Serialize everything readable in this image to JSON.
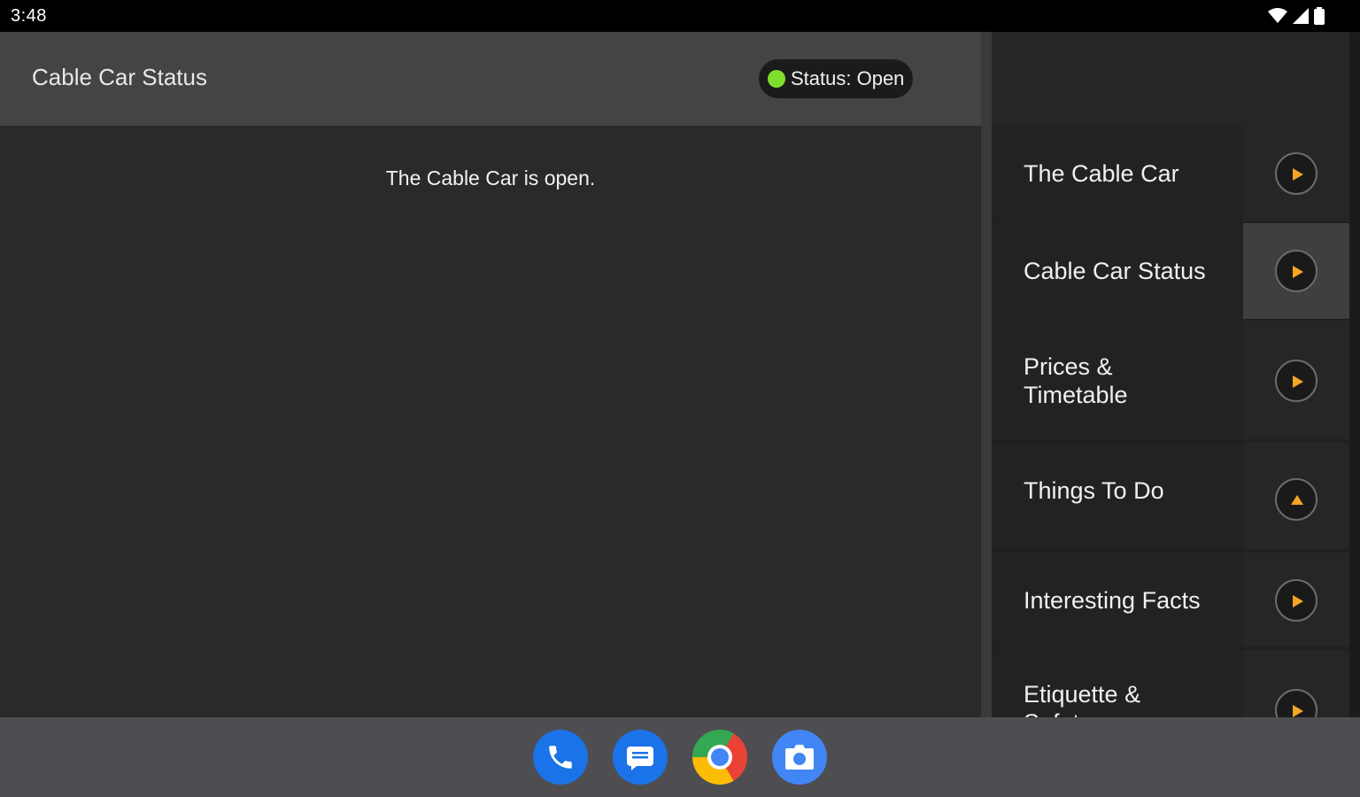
{
  "status_bar": {
    "time": "3:48",
    "icons": [
      "wifi-icon",
      "cell-signal-icon",
      "battery-icon"
    ]
  },
  "header": {
    "title": "Cable Car Status",
    "status_label": "Status: Open",
    "status_color": "#7ee02c"
  },
  "main": {
    "message": "The Cable Car is open."
  },
  "menu": {
    "items": [
      {
        "label": "The Cable Car",
        "icon": "play-icon"
      },
      {
        "label": "Cable Car Status",
        "icon": "play-icon",
        "active": true
      },
      {
        "label": "Prices &\nTimetable",
        "icon": "play-icon"
      },
      {
        "label": "Things To Do",
        "icon": "expand-up-icon"
      },
      {
        "label": "Interesting Facts",
        "icon": "play-icon"
      },
      {
        "label": "Etiquette &\nSafety",
        "icon": "play-icon"
      }
    ]
  },
  "dock": {
    "apps": [
      "phone-icon",
      "messages-icon",
      "chrome-icon",
      "camera-icon"
    ]
  },
  "colors": {
    "accent": "#f5a623",
    "background": "#2a2a2b",
    "header": "#444445"
  }
}
